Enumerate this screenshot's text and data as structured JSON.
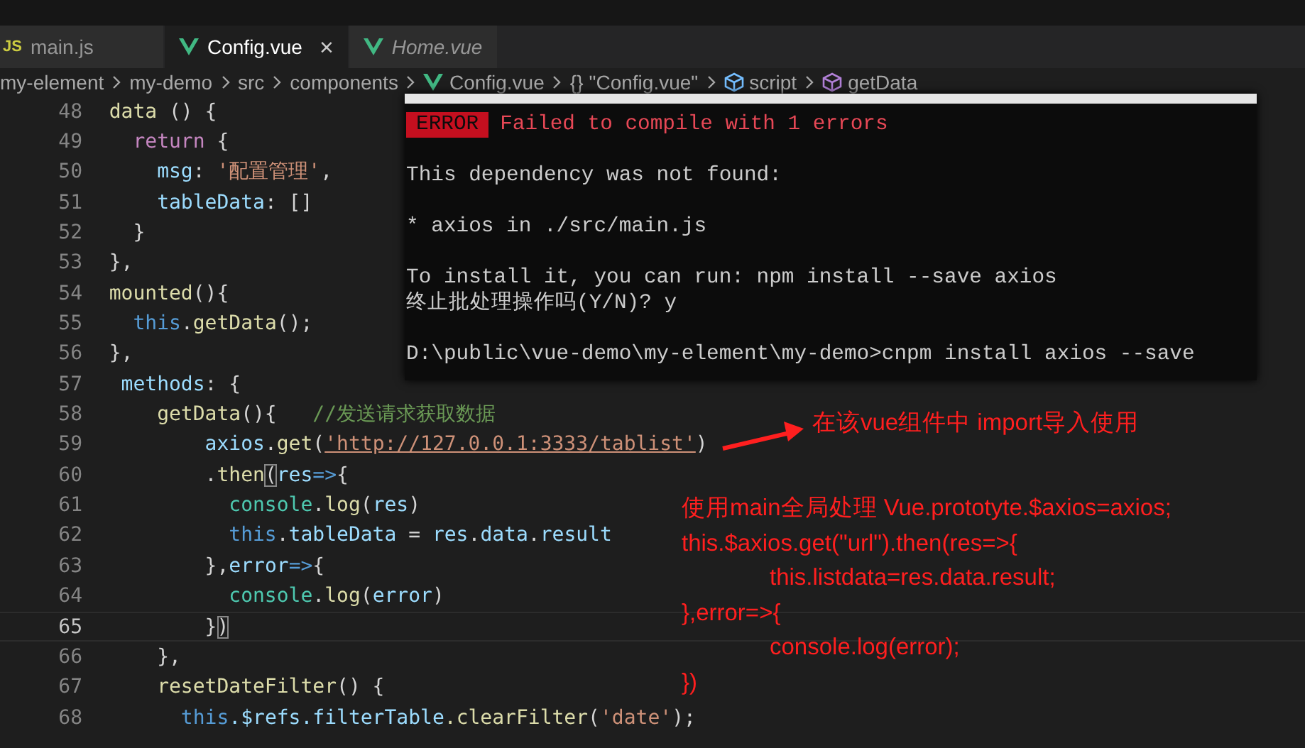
{
  "tabs": [
    {
      "kind": "js",
      "icon_label": "JS",
      "label": "main.js",
      "selected": false,
      "preview": false
    },
    {
      "kind": "vue",
      "label": "Config.vue",
      "selected": true,
      "preview": false,
      "close": "×"
    },
    {
      "kind": "vue",
      "label": "Home.vue",
      "selected": false,
      "preview": true
    }
  ],
  "breadcrumb": [
    {
      "kind": "plain",
      "label": "my-element"
    },
    {
      "kind": "plain",
      "label": "my-demo"
    },
    {
      "kind": "plain",
      "label": "src"
    },
    {
      "kind": "plain",
      "label": "components"
    },
    {
      "kind": "vue",
      "label": "Config.vue"
    },
    {
      "kind": "braces",
      "symbol": "{}",
      "label": "\"Config.vue\""
    },
    {
      "kind": "script",
      "label": "script"
    },
    {
      "kind": "method",
      "label": "getData"
    }
  ],
  "code_lines": [
    {
      "number": "48",
      "current": false,
      "tokens": [
        {
          "kind": "function",
          "text": "  data"
        },
        {
          "kind": "plain",
          "text": " () {"
        }
      ]
    },
    {
      "number": "49",
      "current": false,
      "tokens": [
        {
          "kind": "keyword",
          "text": "    return"
        },
        {
          "kind": "plain",
          "text": " {"
        }
      ]
    },
    {
      "number": "50",
      "current": false,
      "tokens": [
        {
          "kind": "property",
          "text": "      msg"
        },
        {
          "kind": "plain",
          "text": ": "
        },
        {
          "kind": "string",
          "text": "'配置管理'"
        },
        {
          "kind": "plain",
          "text": ","
        }
      ]
    },
    {
      "number": "51",
      "current": false,
      "tokens": [
        {
          "kind": "property",
          "text": "      tableData"
        },
        {
          "kind": "plain",
          "text": ": []"
        }
      ]
    },
    {
      "number": "52",
      "current": false,
      "tokens": [
        {
          "kind": "plain",
          "text": "    }"
        }
      ]
    },
    {
      "number": "53",
      "current": false,
      "tokens": [
        {
          "kind": "plain",
          "text": "  },"
        }
      ]
    },
    {
      "number": "54",
      "current": false,
      "tokens": [
        {
          "kind": "function",
          "text": "  mounted"
        },
        {
          "kind": "plain",
          "text": "(){"
        }
      ]
    },
    {
      "number": "55",
      "current": false,
      "tokens": [
        {
          "kind": "this",
          "text": "    this"
        },
        {
          "kind": "plain",
          "text": "."
        },
        {
          "kind": "function",
          "text": "getData"
        },
        {
          "kind": "plain",
          "text": "();"
        }
      ]
    },
    {
      "number": "56",
      "current": false,
      "tokens": [
        {
          "kind": "plain",
          "text": "  },"
        }
      ]
    },
    {
      "number": "57",
      "current": false,
      "tokens": [
        {
          "kind": "property",
          "text": "   methods"
        },
        {
          "kind": "plain",
          "text": ": {"
        }
      ]
    },
    {
      "number": "58",
      "current": false,
      "tokens": [
        {
          "kind": "function",
          "text": "      getData"
        },
        {
          "kind": "plain",
          "text": "(){   "
        },
        {
          "kind": "comment",
          "text": "//发送请求获取数据"
        }
      ]
    },
    {
      "number": "59",
      "current": false,
      "tokens": [
        {
          "kind": "property",
          "text": "          axios"
        },
        {
          "kind": "plain",
          "text": "."
        },
        {
          "kind": "function",
          "text": "get"
        },
        {
          "kind": "plain",
          "text": "("
        },
        {
          "kind": "link",
          "text": "'http://127.0.0.1:3333/tablist'"
        },
        {
          "kind": "plain",
          "text": ")"
        }
      ]
    },
    {
      "number": "60",
      "current": false,
      "tokens": [
        {
          "kind": "plain",
          "text": "          ."
        },
        {
          "kind": "function",
          "text": "then"
        },
        {
          "kind": "bracket",
          "text": "("
        },
        {
          "kind": "property",
          "text": "res"
        },
        {
          "kind": "this",
          "text": "=>"
        },
        {
          "kind": "plain",
          "text": "{"
        }
      ]
    },
    {
      "number": "61",
      "current": false,
      "tokens": [
        {
          "kind": "type",
          "text": "            console"
        },
        {
          "kind": "plain",
          "text": "."
        },
        {
          "kind": "function",
          "text": "log"
        },
        {
          "kind": "plain",
          "text": "("
        },
        {
          "kind": "property",
          "text": "res"
        },
        {
          "kind": "plain",
          "text": ")"
        }
      ]
    },
    {
      "number": "62",
      "current": false,
      "tokens": [
        {
          "kind": "this",
          "text": "            this"
        },
        {
          "kind": "plain",
          "text": "."
        },
        {
          "kind": "property",
          "text": "tableData"
        },
        {
          "kind": "plain",
          "text": " = "
        },
        {
          "kind": "property",
          "text": "res"
        },
        {
          "kind": "plain",
          "text": "."
        },
        {
          "kind": "property",
          "text": "data"
        },
        {
          "kind": "plain",
          "text": "."
        },
        {
          "kind": "property",
          "text": "result"
        }
      ]
    },
    {
      "number": "63",
      "current": false,
      "tokens": [
        {
          "kind": "plain",
          "text": "          },"
        },
        {
          "kind": "property",
          "text": "error"
        },
        {
          "kind": "this",
          "text": "=>"
        },
        {
          "kind": "plain",
          "text": "{"
        }
      ]
    },
    {
      "number": "64",
      "current": false,
      "tokens": [
        {
          "kind": "type",
          "text": "            console"
        },
        {
          "kind": "plain",
          "text": "."
        },
        {
          "kind": "function",
          "text": "log"
        },
        {
          "kind": "plain",
          "text": "("
        },
        {
          "kind": "property",
          "text": "error"
        },
        {
          "kind": "plain",
          "text": ")"
        }
      ]
    },
    {
      "number": "65",
      "current": true,
      "tokens": [
        {
          "kind": "plain",
          "text": "          }"
        },
        {
          "kind": "bracket",
          "text": ")"
        }
      ]
    },
    {
      "number": "66",
      "current": false,
      "tokens": [
        {
          "kind": "plain",
          "text": "      },"
        }
      ]
    },
    {
      "number": "67",
      "current": false,
      "tokens": [
        {
          "kind": "function",
          "text": "      resetDateFilter"
        },
        {
          "kind": "plain",
          "text": "() {"
        }
      ]
    },
    {
      "number": "68",
      "current": false,
      "tokens": [
        {
          "kind": "this",
          "text": "        this"
        },
        {
          "kind": "property",
          "text": ".$refs"
        },
        {
          "kind": "property",
          "text": ".filterTable"
        },
        {
          "kind": "function",
          "text": ".clearFilter"
        },
        {
          "kind": "plain",
          "text": "("
        },
        {
          "kind": "string",
          "text": "'date'"
        },
        {
          "kind": "plain",
          "text": ");"
        }
      ]
    }
  ],
  "terminal": {
    "blocks": [
      [
        {
          "kind": "error",
          "badge": "ERROR",
          "text": "Failed to compile with 1 errors"
        }
      ],
      [
        {
          "kind": "text",
          "text": "This dependency was not found:"
        }
      ],
      [
        {
          "kind": "text",
          "text": "* axios in ./src/main.js"
        }
      ],
      [
        {
          "kind": "text",
          "text": "To install it, you can run: npm install --save axios"
        },
        {
          "kind": "text",
          "text": "终止批处理操作吗(Y/N)? y"
        }
      ],
      [
        {
          "kind": "text",
          "text": "D:\\public\\vue-demo\\my-element\\my-demo>cnpm install axios --save"
        }
      ]
    ]
  },
  "annotations": {
    "arrow_note": "在该vue组件中 import导入使用",
    "notes": [
      {
        "kind": "plain",
        "text": "使用main全局处理 Vue.prototyte.$axios=axios;"
      },
      {
        "kind": "plain",
        "text": "this.$axios.get(\"url\").then(res=>{"
      },
      {
        "kind": "indented",
        "text": "this.listdata=res.data.result;"
      },
      {
        "kind": "plain",
        "text": "},error=>{"
      },
      {
        "kind": "indented",
        "text": "console.log(error);"
      },
      {
        "kind": "plain",
        "text": "})"
      }
    ]
  }
}
